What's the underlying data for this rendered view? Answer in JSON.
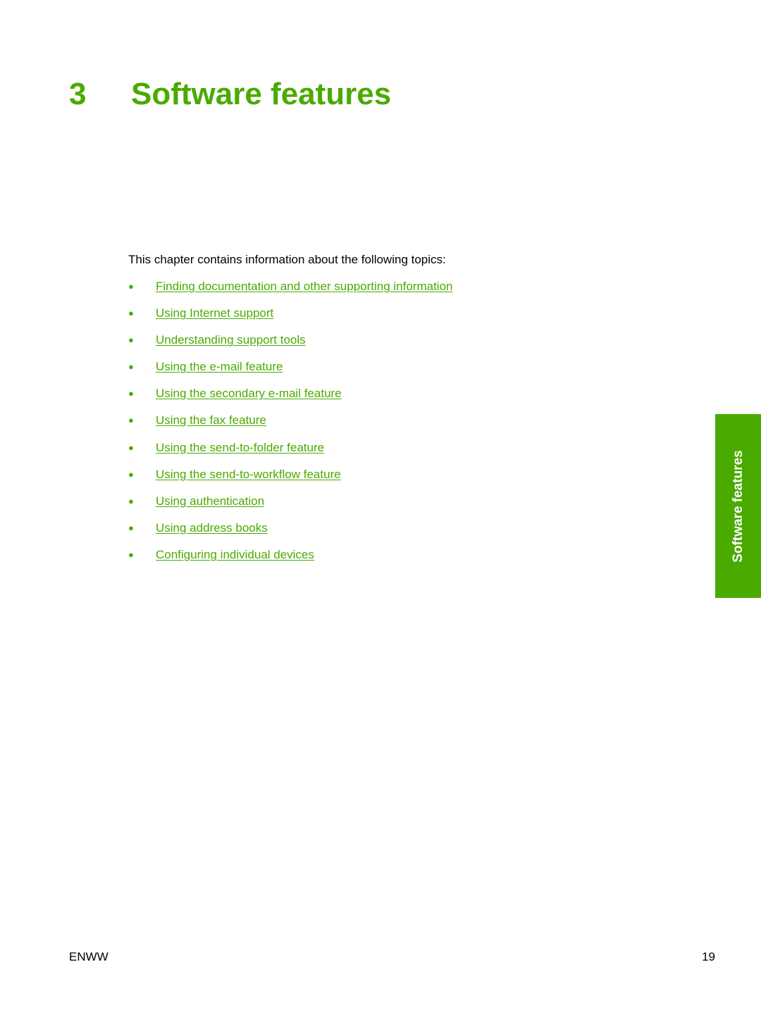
{
  "chapter": {
    "number": "3",
    "title": "Software features"
  },
  "intro": "This chapter contains information about the following topics:",
  "topics": [
    "Finding documentation and other supporting information",
    "Using Internet support",
    "Understanding support tools",
    "Using the e-mail feature",
    "Using the secondary e-mail feature",
    "Using the fax feature",
    "Using the send-to-folder feature",
    "Using the send-to-workflow feature",
    "Using authentication",
    "Using address books",
    "Configuring individual devices"
  ],
  "side_tab": "Software features",
  "footer": {
    "left": "ENWW",
    "page_number": "19"
  },
  "colors": {
    "accent": "#4aaa00"
  }
}
